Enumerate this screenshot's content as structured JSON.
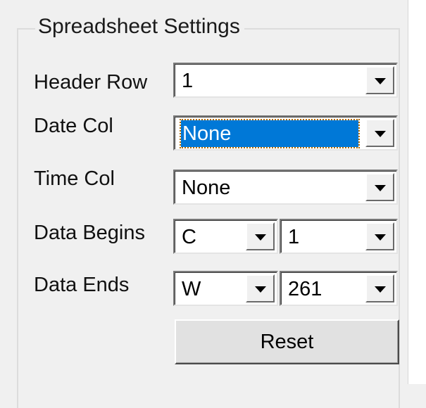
{
  "group": {
    "title": "Spreadsheet Settings"
  },
  "rows": {
    "header_row": {
      "label": "Header Row",
      "value": "1"
    },
    "date_col": {
      "label": "Date Col",
      "value": "None"
    },
    "time_col": {
      "label": "Time Col",
      "value": "None"
    },
    "data_begins": {
      "label": "Data Begins",
      "col_value": "C",
      "row_value": "1"
    },
    "data_ends": {
      "label": "Data Ends",
      "col_value": "W",
      "row_value": "261"
    }
  },
  "reset_button": {
    "label": "Reset"
  },
  "colors": {
    "selection": "#0078d7",
    "panel": "#f0f0f0"
  },
  "icons": {
    "dropdown": "chevron-down-icon"
  }
}
